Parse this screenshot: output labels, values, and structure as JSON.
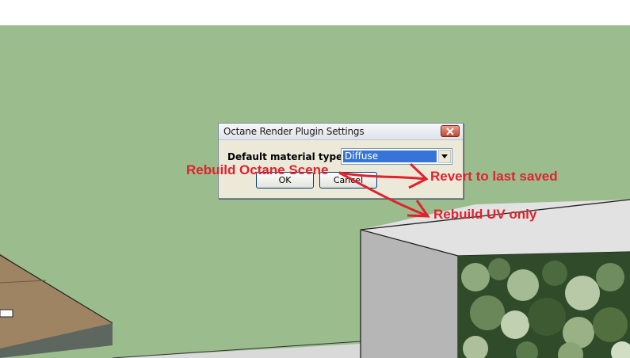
{
  "dialog": {
    "title": "Octane Render Plugin Settings",
    "field_label": "Default material type",
    "select_value": "Diffuse",
    "ok_label": "OK",
    "cancel_label": "Cancel"
  },
  "annotations": {
    "rebuild_octane_scene": "Rebuild Octane Scene",
    "revert_to_last_saved": "Revert to last saved",
    "rebuild_uv_only": "Rebuild UV only"
  },
  "colors": {
    "ground": "#9bbd8e",
    "annotation": "#e0222e",
    "selection": "#3874d8"
  },
  "icons": {
    "close": "close-icon",
    "dropdown": "chevron-down-icon"
  }
}
